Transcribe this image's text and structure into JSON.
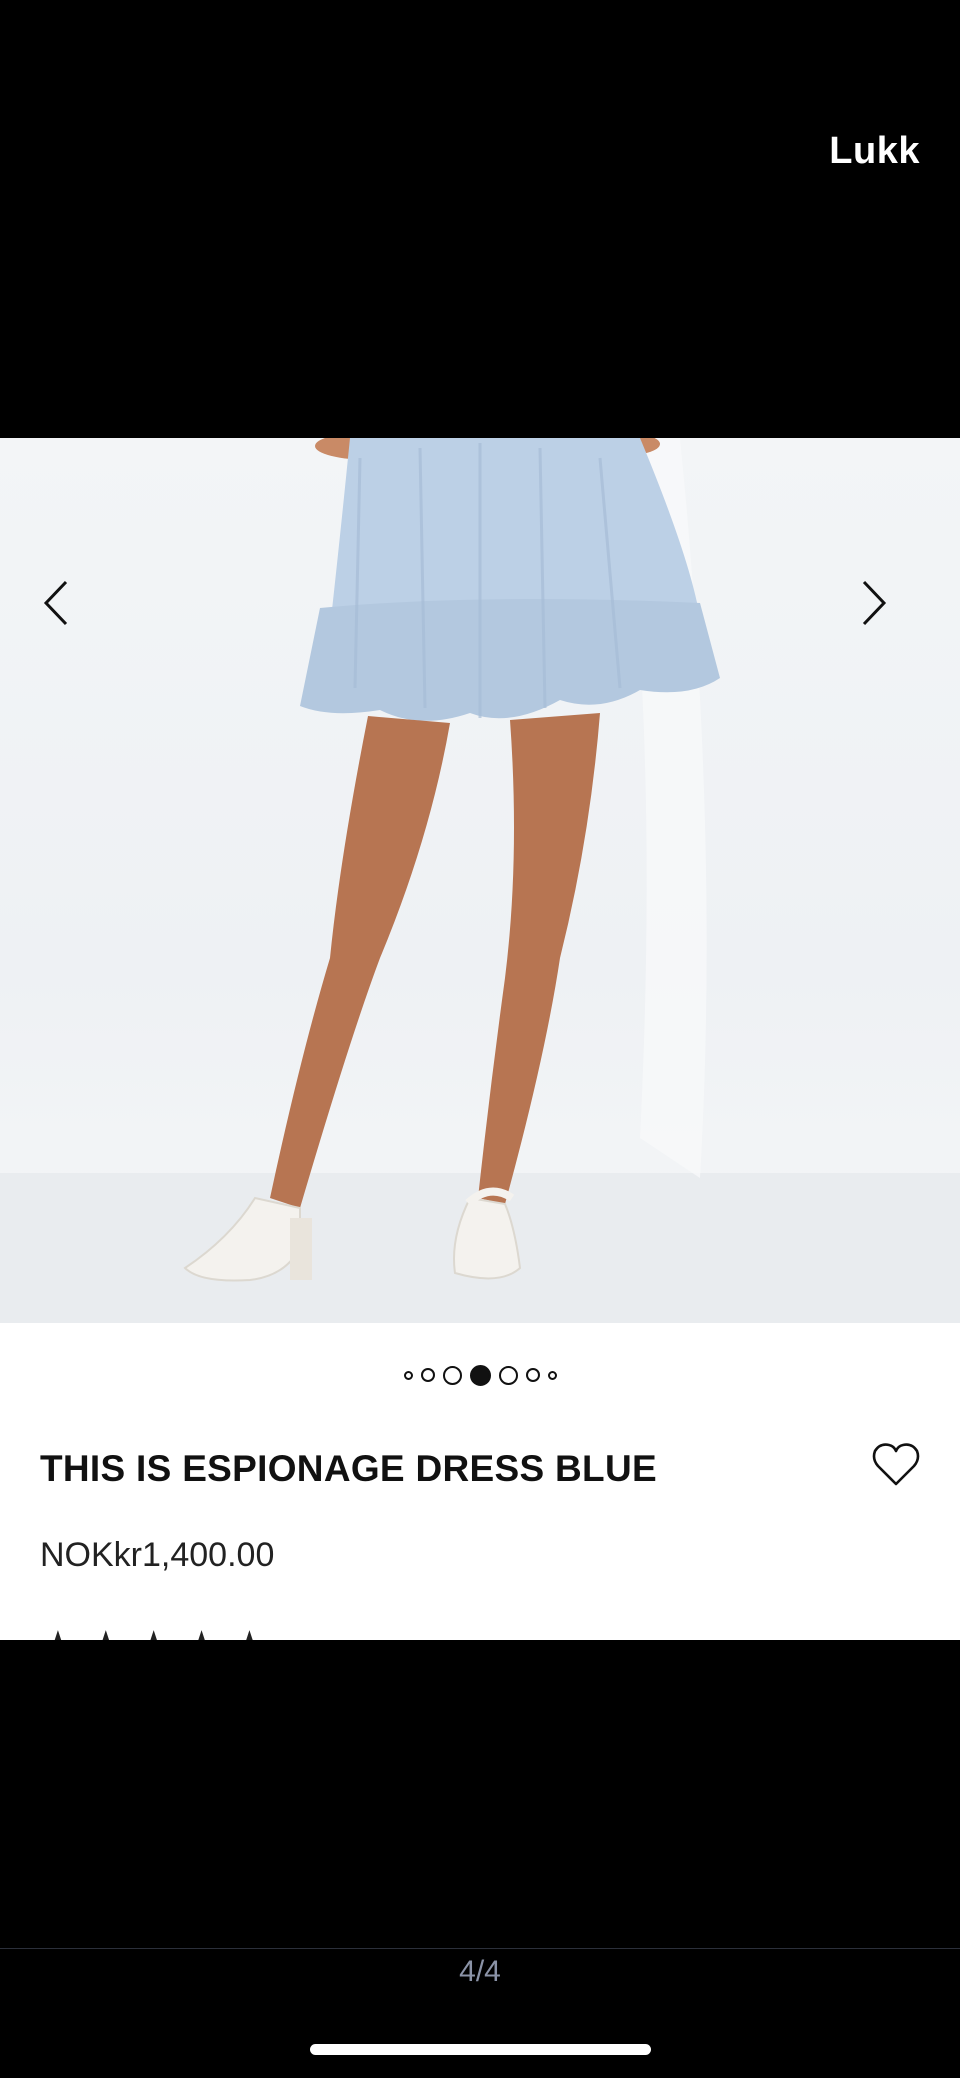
{
  "overlay": {
    "close_label": "Lukk",
    "counter": "4/4"
  },
  "product": {
    "title": "THIS IS ESPIONAGE DRESS BLUE",
    "price": "NOKkr1,400.00",
    "rating_stars": "★★★★★"
  },
  "gallery": {
    "prev_icon": "chevron-left-icon",
    "next_icon": "chevron-right-icon",
    "dots_total": 7,
    "active_dot": 4
  },
  "colors": {
    "background": "#000000",
    "card": "#ffffff",
    "text": "#111111",
    "counter": "#8b93a7"
  }
}
